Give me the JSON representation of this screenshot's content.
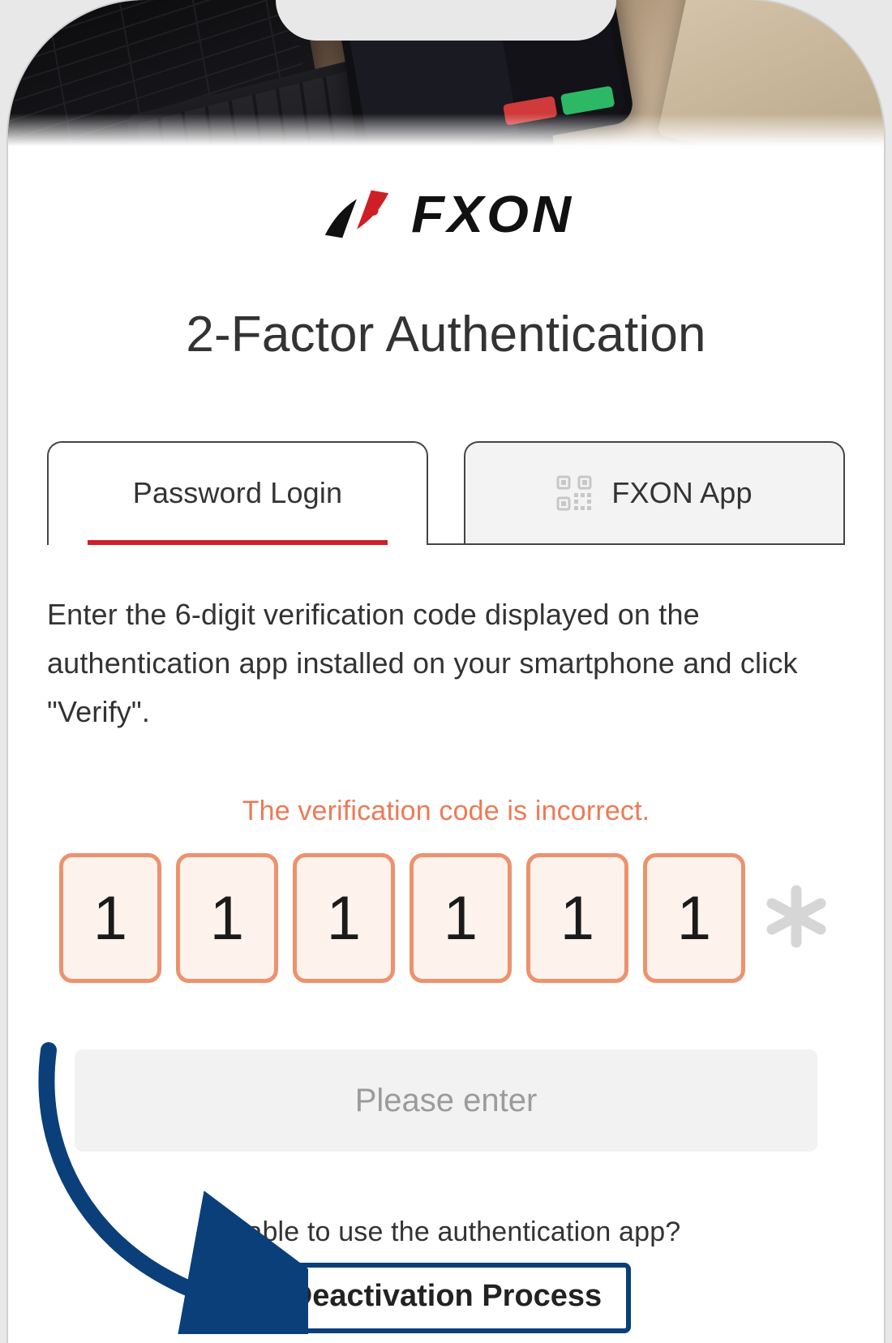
{
  "brand": {
    "name": "FXON"
  },
  "title": "2-Factor Authentication",
  "tabs": {
    "password": "Password Login",
    "app": "FXON App"
  },
  "instruction": "Enter the 6-digit verification code displayed on the authentication app installed on your smartphone and click \"Verify\".",
  "error": "The verification code is incorrect.",
  "code": {
    "d0": "1",
    "d1": "1",
    "d2": "1",
    "d3": "1",
    "d4": "1",
    "d5": "1"
  },
  "verify_button": "Please enter",
  "footer": {
    "question": "Unable to use the authentication app?",
    "deactivate": "Deactivation Process"
  },
  "colors": {
    "accent_red": "#cf1f26",
    "error_orange": "#ed7a56",
    "input_border": "#ec926f",
    "callout_blue": "#0a3f7a"
  }
}
